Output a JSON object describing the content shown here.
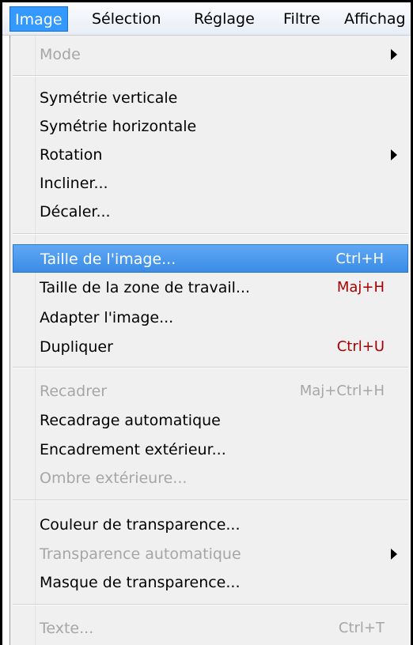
{
  "menubar": {
    "items": [
      {
        "label": "Image"
      },
      {
        "label": "Sélection"
      },
      {
        "label": "Réglage"
      },
      {
        "label": "Filtre"
      },
      {
        "label": "Affichag"
      }
    ]
  },
  "menu": {
    "groups": [
      {
        "items": [
          {
            "label": "Mode",
            "shortcut": "",
            "disabled": true,
            "submenu": true
          }
        ]
      },
      {
        "items": [
          {
            "label": "Symétrie verticale",
            "shortcut": ""
          },
          {
            "label": "Symétrie horizontale",
            "shortcut": ""
          },
          {
            "label": "Rotation",
            "shortcut": "",
            "submenu": true
          },
          {
            "label": "Incliner...",
            "shortcut": ""
          },
          {
            "label": "Décaler...",
            "shortcut": ""
          }
        ]
      },
      {
        "items": [
          {
            "label": "Taille de l'image...",
            "shortcut": "Ctrl+H",
            "selected": true
          },
          {
            "label": "Taille de la zone de travail...",
            "shortcut": "Maj+H"
          },
          {
            "label": "Adapter l'image...",
            "shortcut": ""
          },
          {
            "label": "Dupliquer",
            "shortcut": "Ctrl+U"
          }
        ]
      },
      {
        "items": [
          {
            "label": "Recadrer",
            "shortcut": "Maj+Ctrl+H",
            "disabled": true
          },
          {
            "label": "Recadrage automatique",
            "shortcut": ""
          },
          {
            "label": "Encadrement extérieur...",
            "shortcut": ""
          },
          {
            "label": "Ombre extérieure...",
            "shortcut": "",
            "disabled": true
          }
        ]
      },
      {
        "items": [
          {
            "label": "Couleur de transparence...",
            "shortcut": ""
          },
          {
            "label": "Transparence automatique",
            "shortcut": "",
            "disabled": true,
            "submenu": true
          },
          {
            "label": "Masque de transparence...",
            "shortcut": ""
          }
        ]
      },
      {
        "items": [
          {
            "label": "Texte...",
            "shortcut": "Ctrl+T",
            "disabled": true
          }
        ]
      }
    ]
  },
  "colors": {
    "highlight": "#3399ff",
    "shortcut_text": "#a80000",
    "disabled_text": "#a6a6a6"
  }
}
